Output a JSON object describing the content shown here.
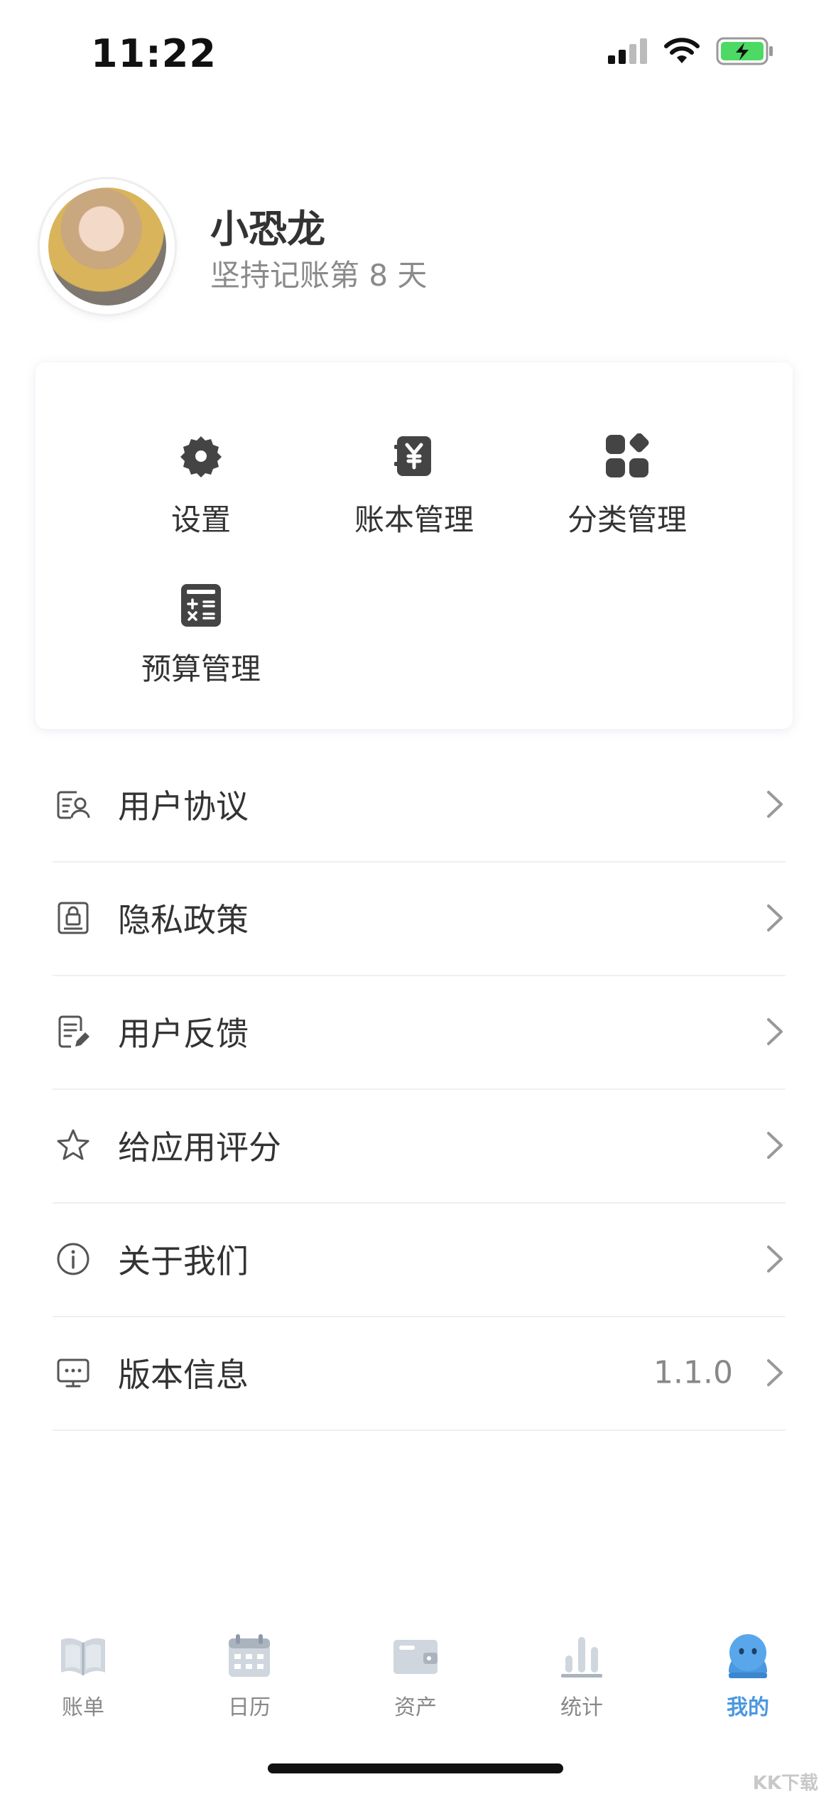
{
  "status_bar": {
    "time": "11:22",
    "battery_color": "#4cd964"
  },
  "profile": {
    "name": "小恐龙",
    "subtitle": "坚持记账第 8 天"
  },
  "quick_actions": [
    {
      "label": "设置",
      "icon": "gear-icon"
    },
    {
      "label": "账本管理",
      "icon": "ledger-icon"
    },
    {
      "label": "分类管理",
      "icon": "category-icon"
    },
    {
      "label": "预算管理",
      "icon": "calculator-icon"
    }
  ],
  "menu": [
    {
      "label": "用户协议",
      "icon": "user-agreement-icon",
      "value": ""
    },
    {
      "label": "隐私政策",
      "icon": "privacy-lock-icon",
      "value": ""
    },
    {
      "label": "用户反馈",
      "icon": "feedback-icon",
      "value": ""
    },
    {
      "label": "给应用评分",
      "icon": "star-icon",
      "value": ""
    },
    {
      "label": "关于我们",
      "icon": "info-icon",
      "value": ""
    },
    {
      "label": "版本信息",
      "icon": "monitor-icon",
      "value": "1.1.0"
    }
  ],
  "tabs": [
    {
      "label": "账单",
      "icon": "book-icon"
    },
    {
      "label": "日历",
      "icon": "calendar-icon"
    },
    {
      "label": "资产",
      "icon": "wallet-icon"
    },
    {
      "label": "统计",
      "icon": "bar-chart-icon"
    },
    {
      "label": "我的",
      "icon": "profile-face-icon",
      "active": true
    }
  ],
  "colors": {
    "accent": "#4a98e0",
    "icon_dark": "#444444",
    "text": "#333333",
    "muted": "#888888"
  },
  "watermark": "KK下载"
}
